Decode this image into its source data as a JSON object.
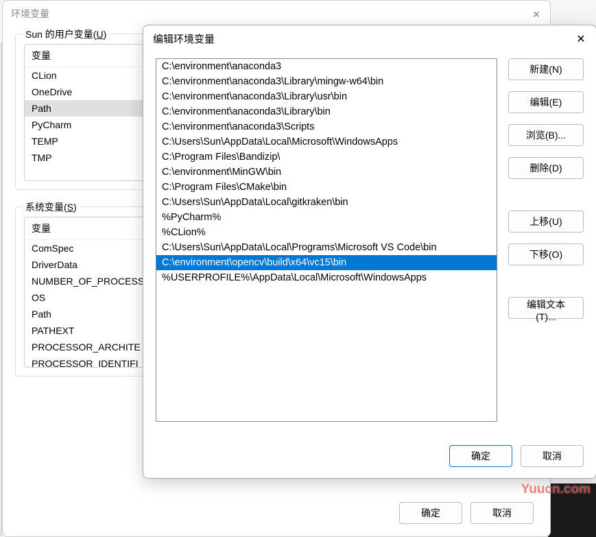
{
  "back": {
    "title": "环境变量",
    "user_section": {
      "label_prefix": "Sun 的用户变量(",
      "label_key": "U",
      "label_suffix": ")",
      "header": "变量",
      "vars": [
        "CLion",
        "OneDrive",
        "Path",
        "PyCharm",
        "TEMP",
        "TMP"
      ],
      "selected_index": 2
    },
    "sys_section": {
      "label_prefix": "系统变量(",
      "label_key": "S",
      "label_suffix": ")",
      "header": "变量",
      "vars": [
        "ComSpec",
        "DriverData",
        "NUMBER_OF_PROCESS",
        "OS",
        "Path",
        "PATHEXT",
        "PROCESSOR_ARCHITE",
        "PROCESSOR_IDENTIFI"
      ]
    },
    "ok": "确定",
    "cancel": "取消"
  },
  "front": {
    "title": "编辑环境变量",
    "paths": [
      "C:\\environment\\anaconda3",
      "C:\\environment\\anaconda3\\Library\\mingw-w64\\bin",
      "C:\\environment\\anaconda3\\Library\\usr\\bin",
      "C:\\environment\\anaconda3\\Library\\bin",
      "C:\\environment\\anaconda3\\Scripts",
      "C:\\Users\\Sun\\AppData\\Local\\Microsoft\\WindowsApps",
      "C:\\Program Files\\Bandizip\\",
      "C:\\environment\\MinGW\\bin",
      "C:\\Program Files\\CMake\\bin",
      "C:\\Users\\Sun\\AppData\\Local\\gitkraken\\bin",
      "%PyCharm%",
      "%CLion%",
      "C:\\Users\\Sun\\AppData\\Local\\Programs\\Microsoft VS Code\\bin",
      "C:\\environment\\opencv\\build\\x64\\vc15\\bin",
      "%USERPROFILE%\\AppData\\Local\\Microsoft\\WindowsApps"
    ],
    "selected_index": 13,
    "buttons": {
      "new": "新建(N)",
      "edit": "编辑(E)",
      "browse": "浏览(B)...",
      "delete": "删除(D)",
      "move_up": "上移(U)",
      "move_down": "下移(O)",
      "edit_text": "编辑文本(T)..."
    },
    "ok": "确定",
    "cancel": "取消"
  },
  "watermark": "Yuucn.com"
}
